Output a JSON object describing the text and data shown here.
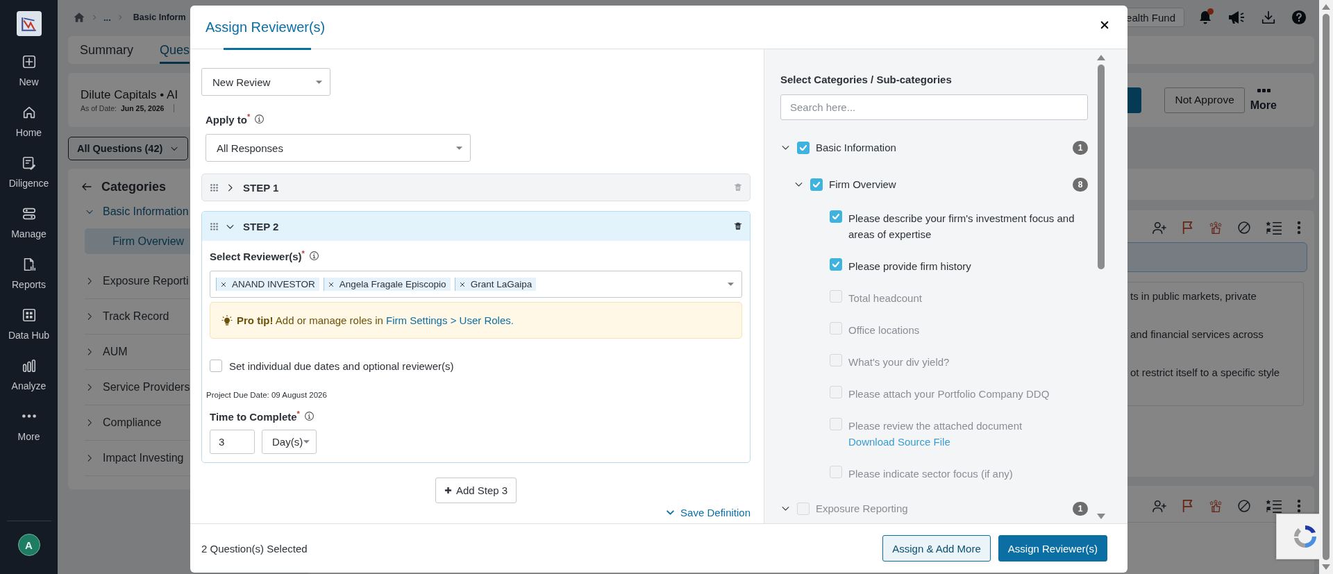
{
  "sidebar": {
    "items": [
      {
        "label": "New"
      },
      {
        "label": "Home"
      },
      {
        "label": "Diligence"
      },
      {
        "label": "Manage"
      },
      {
        "label": "Reports"
      },
      {
        "label": "Data Hub"
      },
      {
        "label": "Analyze"
      },
      {
        "label": "More"
      }
    ],
    "avatar": "A"
  },
  "breadcrumb": {
    "ellipsis": "...",
    "current": "Basic Inform"
  },
  "fund_button": "ealth Fund",
  "page_tabs": [
    {
      "label": "Summary",
      "selected": false
    },
    {
      "label": "Ques",
      "selected": true
    }
  ],
  "project": {
    "title": "Dilute Capitals • AI",
    "date_label": "As of Date:",
    "date": "Jun 25, 2026",
    "not_approve": "Not Approve",
    "more": "More"
  },
  "question_filter": "All Questions (42)",
  "categories": {
    "title": "Categories",
    "items": [
      {
        "label": "Basic Information",
        "expanded": true,
        "children": [
          {
            "label": "Firm Overview",
            "selected": true
          }
        ]
      },
      {
        "label": "Exposure Reporti",
        "expanded": false
      },
      {
        "label": "Track Record",
        "expanded": false
      },
      {
        "label": "AUM",
        "expanded": false
      },
      {
        "label": "Service Providers",
        "expanded": false
      },
      {
        "label": "Compliance",
        "expanded": false
      },
      {
        "label": "Impact Investing",
        "expanded": false
      }
    ]
  },
  "answer_excerpt": [
    "ts in public markets, private",
    "and financial services across",
    "ot restrict itself to a specific style"
  ],
  "modal": {
    "title": "Assign Reviewer(s)",
    "review_type": "New Review",
    "apply_to_label": "Apply to$^{*}$",
    "apply_to": "All Responses",
    "steps": [
      {
        "label": "STEP 1",
        "expanded": false
      },
      {
        "label": "STEP 2",
        "expanded": true,
        "reviewers_label": "Select Reviewer(s)$^{*}$",
        "reviewers": [
          "ANAND INVESTOR",
          "Angela Fragale Episcopio",
          "Grant LaGaipa"
        ],
        "tip": "**Pro tip!** Add or manage roles in",
        "tip_link": "Firm Settings > User Roles.",
        "individual_dates": {
          "label": "Set individual due dates and optional reviewer(s)",
          "checked": false
        },
        "due_date": "Project Due Date: 09 August 2026",
        "time_label": "Time to Complete$^{*}$",
        "time_value": "3",
        "time_unit": "Day(s)"
      }
    ],
    "add_step": "Add Step 3",
    "save_definition": "Save Definition",
    "selected_count": "2 Question(s) Selected",
    "buttons": [
      {
        "label": "Assign & Add More",
        "kind": "secondary"
      },
      {
        "label": "Assign Reviewer(s)",
        "kind": "primary"
      }
    ],
    "categories_panel": {
      "title": "Select Categories / Sub-categories",
      "search_placeholder": "Search here...",
      "tree": [
        {
          "label": "Basic Information",
          "checked": true,
          "expanded": true,
          "count": "1",
          "children": [
            {
              "label": "Firm Overview",
              "checked": true,
              "expanded": true,
              "count": "8",
              "children": [
                {
                  "label": "Please describe your firm's investment focus and areas of expertise",
                  "checked": true
                },
                {
                  "label": "Please provide firm history",
                  "checked": true
                },
                {
                  "label": "Total headcount",
                  "checked": false
                },
                {
                  "label": "Office locations",
                  "checked": false
                },
                {
                  "label": "What's your div yield?",
                  "checked": false
                },
                {
                  "label": "Please attach your Portfolio Company DDQ",
                  "checked": false
                },
                {
                  "label": "Please review the attached document",
                  "checked": false,
                  "link": "Download Source File"
                },
                {
                  "label": "Please indicate sector focus (if any)",
                  "checked": false
                }
              ]
            }
          ]
        },
        {
          "label": "Exposure Reporting",
          "checked": false,
          "expanded": true,
          "count": "1"
        }
      ]
    }
  }
}
